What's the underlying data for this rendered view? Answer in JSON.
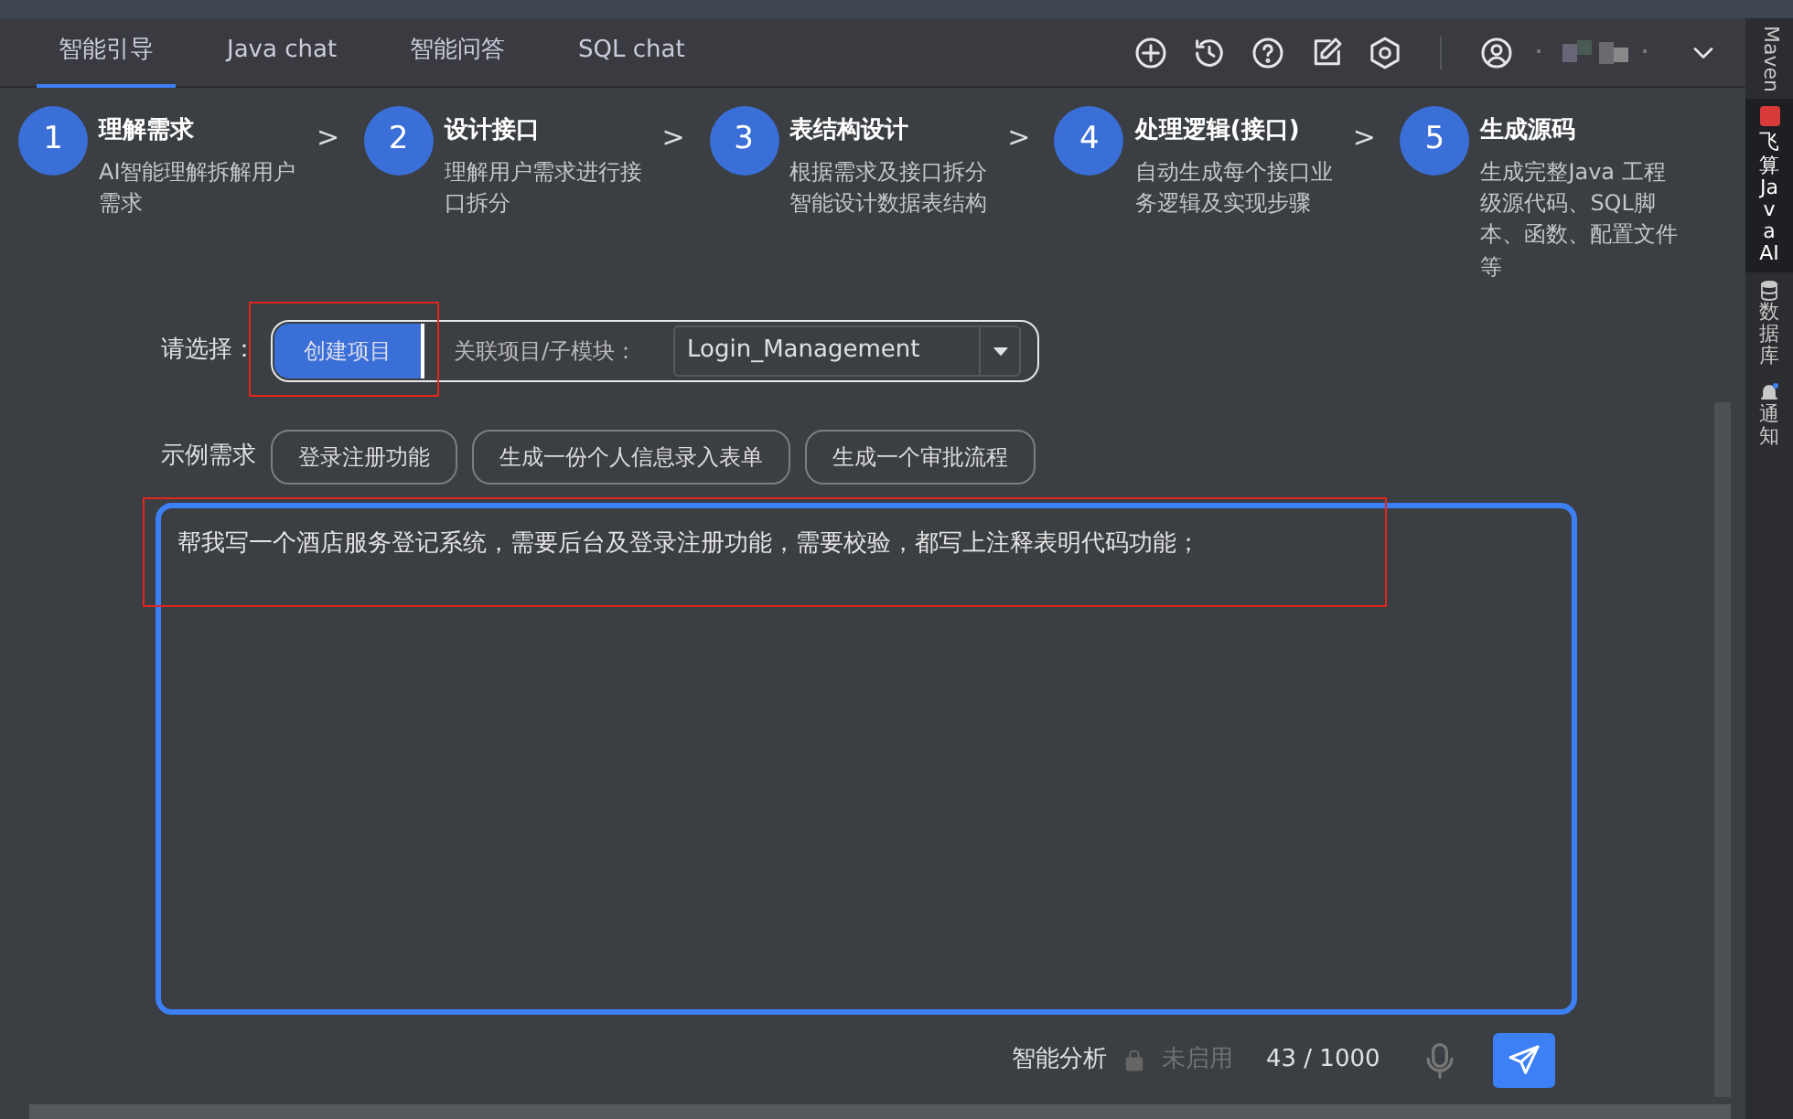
{
  "tabs": [
    {
      "label": "智能引导",
      "selected": true
    },
    {
      "label": "Java chat",
      "selected": false
    },
    {
      "label": "智能问答",
      "selected": false
    },
    {
      "label": "SQL chat",
      "selected": false
    }
  ],
  "steps": [
    {
      "number": "1",
      "title": "理解需求",
      "description": "AI智能理解拆解用户需求",
      "separator": ">"
    },
    {
      "number": "2",
      "title": "设计接口",
      "description": "理解用户需求进行接口拆分",
      "separator": ">"
    },
    {
      "number": "3",
      "title": "表结构设计",
      "description": "根据需求及接口拆分智能设计数据表结构",
      "separator": ">"
    },
    {
      "number": "4",
      "title": "处理逻辑(接口)",
      "description": "自动生成每个接口业务逻辑及实现步骤",
      "separator": ">"
    },
    {
      "number": "5",
      "title": "生成源码",
      "description": "生成完整Java 工程级源代码、SQL脚本、函数、配置文件等"
    }
  ],
  "project_select": {
    "label": "请选择：",
    "modes": [
      {
        "label": "创建项目",
        "selected": true,
        "highlighted": true
      },
      {
        "label": "关联项目/子模块：",
        "selected": false,
        "highlighted": false
      }
    ],
    "dropdown": {
      "value": "Login_Management"
    }
  },
  "examples": {
    "label": "示例需求",
    "items": [
      "登录注册功能",
      "生成一份个人信息录入表单",
      "生成一个审批流程"
    ]
  },
  "prompt": {
    "value": "帮我写一个酒店服务登记系统，需要后台及登录注册功能，需要校验，都写上注释表明代码功能；",
    "highlighted": true
  },
  "footer": {
    "analysis_label": "智能分析",
    "analysis_status": "未启用",
    "analysis_enabled": false,
    "counter": "43 / 1000"
  },
  "side_tools": [
    {
      "label": "Maven",
      "kind": "rotated",
      "selected": false
    },
    {
      "label": "飞算JavaAI",
      "kind": "stacked",
      "selected": true
    },
    {
      "label": "数据库",
      "kind": "stacked",
      "selected": false
    },
    {
      "label": "通知",
      "kind": "stacked",
      "selected": false
    }
  ]
}
